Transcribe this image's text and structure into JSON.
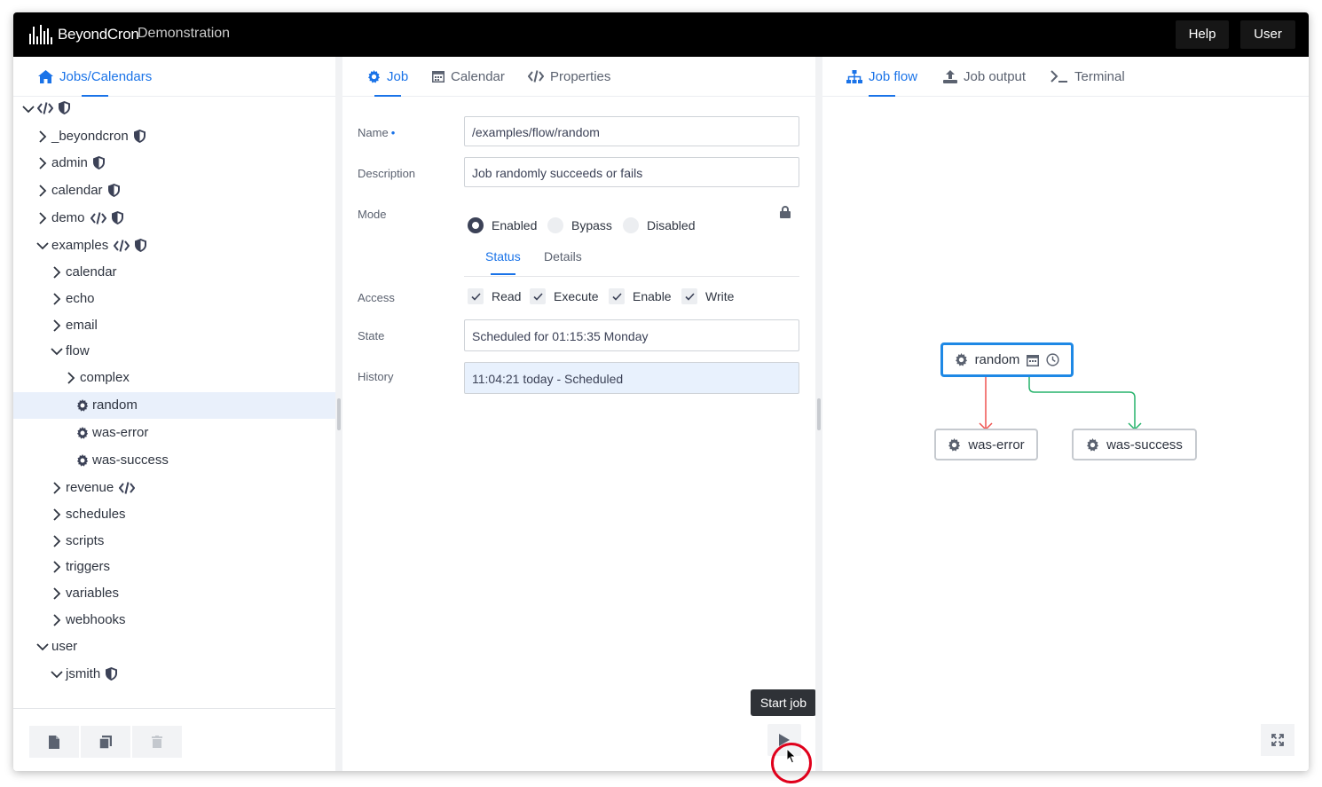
{
  "header": {
    "logo_text": "BeyondCron",
    "environment": "Demonstration",
    "help_label": "Help",
    "user_label": "User"
  },
  "left": {
    "tab_label": "Jobs/Calendars",
    "tree": [
      {
        "label": "",
        "depth": 0,
        "expanded": true,
        "icon": "folder",
        "code": true,
        "shield": true
      },
      {
        "label": "_beyondcron",
        "depth": 1,
        "expanded": false,
        "icon": "folder",
        "code": false,
        "shield": true
      },
      {
        "label": "admin",
        "depth": 1,
        "expanded": false,
        "icon": "folder",
        "code": false,
        "shield": true
      },
      {
        "label": "calendar",
        "depth": 1,
        "expanded": false,
        "icon": "folder",
        "code": false,
        "shield": true
      },
      {
        "label": "demo",
        "depth": 1,
        "expanded": false,
        "icon": "folder",
        "code": true,
        "shield": true
      },
      {
        "label": "examples",
        "depth": 1,
        "expanded": true,
        "icon": "folder",
        "code": true,
        "shield": true
      },
      {
        "label": "calendar",
        "depth": 2,
        "expanded": false,
        "icon": "folder",
        "code": false,
        "shield": false
      },
      {
        "label": "echo",
        "depth": 2,
        "expanded": false,
        "icon": "folder",
        "code": false,
        "shield": false
      },
      {
        "label": "email",
        "depth": 2,
        "expanded": false,
        "icon": "folder",
        "code": false,
        "shield": false
      },
      {
        "label": "flow",
        "depth": 2,
        "expanded": true,
        "icon": "folder",
        "code": false,
        "shield": false
      },
      {
        "label": "complex",
        "depth": 3,
        "expanded": false,
        "icon": "folder",
        "code": false,
        "shield": false
      },
      {
        "label": "random",
        "depth": 3,
        "icon": "job",
        "selected": true
      },
      {
        "label": "was-error",
        "depth": 3,
        "icon": "job"
      },
      {
        "label": "was-success",
        "depth": 3,
        "icon": "job"
      },
      {
        "label": "revenue",
        "depth": 2,
        "expanded": false,
        "icon": "folder",
        "code": true,
        "shield": false
      },
      {
        "label": "schedules",
        "depth": 2,
        "expanded": false,
        "icon": "folder",
        "code": false,
        "shield": false
      },
      {
        "label": "scripts",
        "depth": 2,
        "expanded": false,
        "icon": "folder",
        "code": false,
        "shield": false
      },
      {
        "label": "triggers",
        "depth": 2,
        "expanded": false,
        "icon": "folder",
        "code": false,
        "shield": false
      },
      {
        "label": "variables",
        "depth": 2,
        "expanded": false,
        "icon": "folder",
        "code": false,
        "shield": false
      },
      {
        "label": "webhooks",
        "depth": 2,
        "expanded": false,
        "icon": "folder",
        "code": false,
        "shield": false
      },
      {
        "label": "user",
        "depth": 1,
        "expanded": true,
        "icon": "folder",
        "code": false,
        "shield": false
      },
      {
        "label": "jsmith",
        "depth": 2,
        "expanded": true,
        "icon": "folder",
        "code": false,
        "shield": true
      }
    ],
    "tools": [
      "new-file-icon",
      "copy-icon",
      "trash-icon"
    ]
  },
  "middle": {
    "tabs": [
      "Job",
      "Calendar",
      "Properties"
    ],
    "form": {
      "name_label": "Name",
      "name_value": "/examples/flow/random",
      "description_label": "Description",
      "description_value": "Job randomly succeeds or fails",
      "mode_label": "Mode",
      "mode_options": [
        "Enabled",
        "Bypass",
        "Disabled"
      ],
      "mode_selected": "Enabled",
      "subtabs": [
        "Status",
        "Details"
      ],
      "access_label": "Access",
      "access_options": [
        "Read",
        "Execute",
        "Enable",
        "Write"
      ],
      "state_label": "State",
      "state_value": "Scheduled for 01:15:35 Monday",
      "history_label": "History",
      "history_value": "11:04:21 today - Scheduled"
    },
    "tooltip": "Start job"
  },
  "right": {
    "tabs": [
      "Job flow",
      "Job output",
      "Terminal"
    ],
    "flow": {
      "root": "random",
      "children": [
        {
          "label": "was-error",
          "link": "error",
          "color": "#ef5350"
        },
        {
          "label": "was-success",
          "link": "success",
          "color": "#26b36b"
        }
      ]
    }
  },
  "colors": {
    "accent": "#1a73e8",
    "topbar": "#000000",
    "selected_row": "#e9f0fb"
  }
}
